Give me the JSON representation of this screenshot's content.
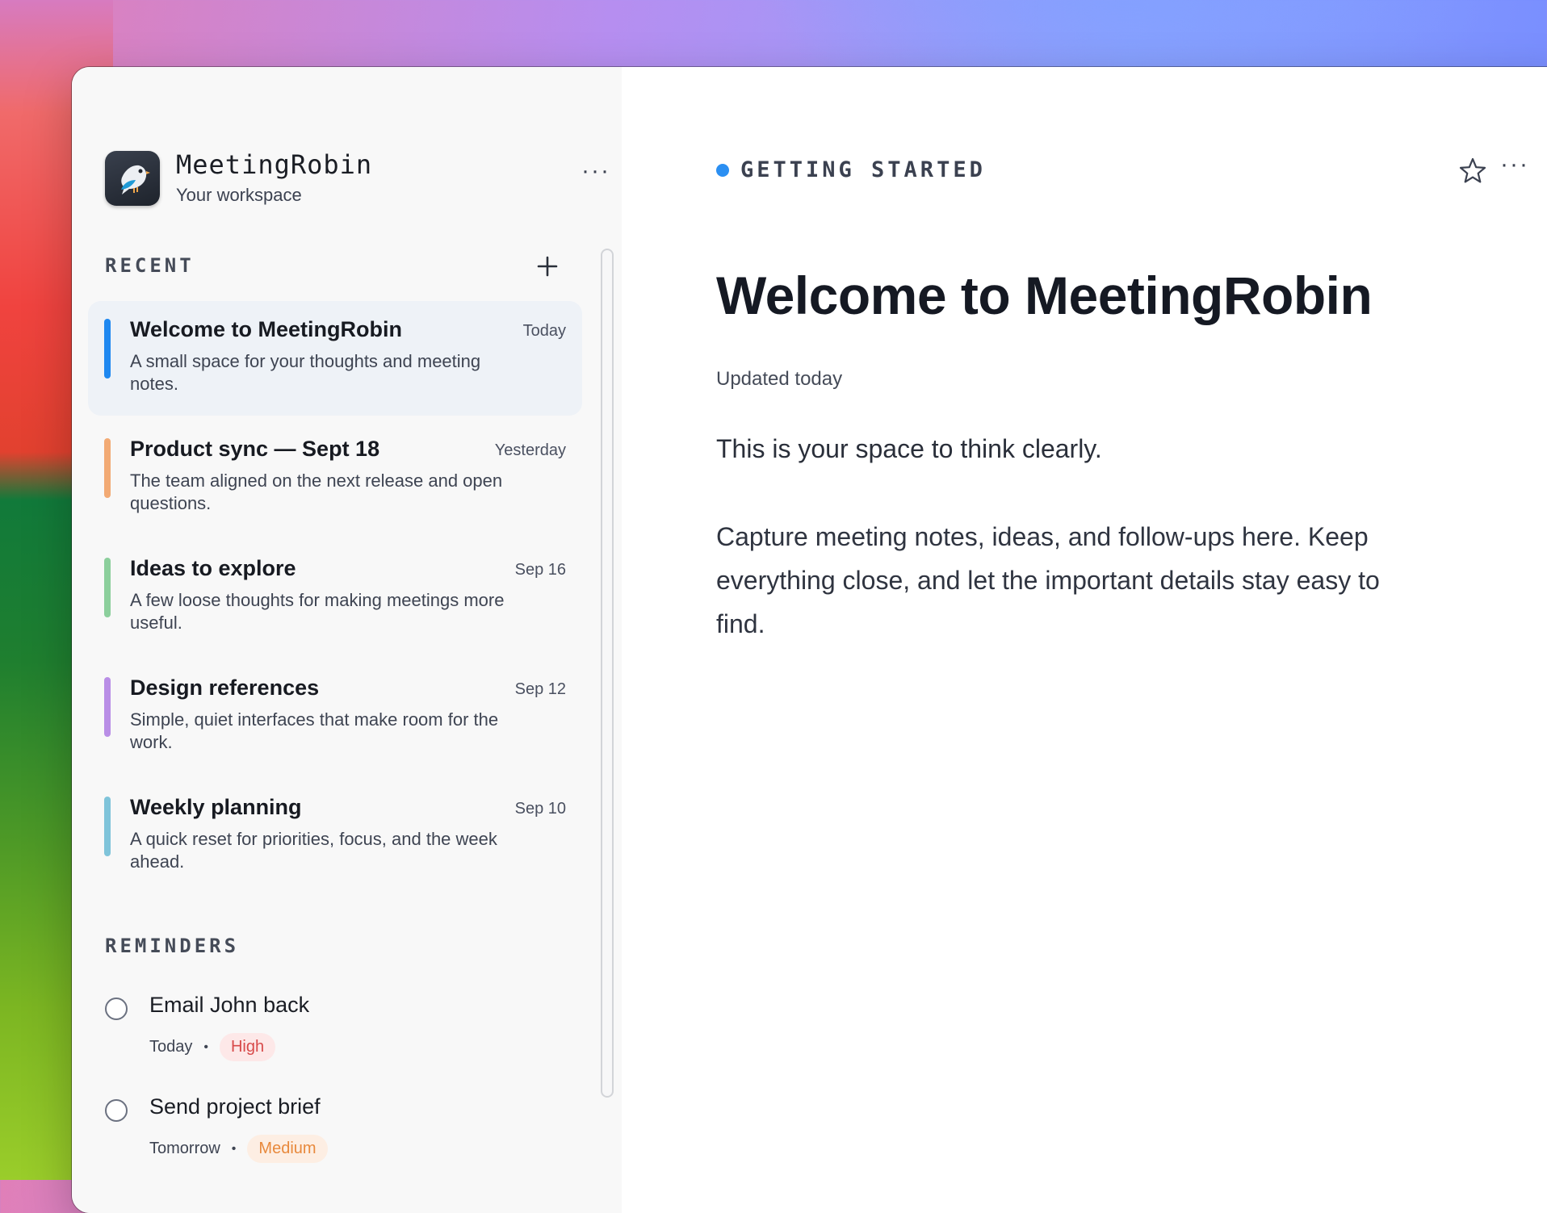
{
  "app": {
    "name": "MeetingRobin",
    "subtitle": "Your workspace",
    "more": "···",
    "logo_icon": "robin-bird-icon"
  },
  "recent": {
    "title": "RECENT",
    "add_icon": "plus-icon",
    "items": [
      {
        "title": "Welcome to MeetingRobin",
        "date": "Today",
        "desc": "A small space for your thoughts and meeting notes.",
        "color": "#1e88f0",
        "active": true
      },
      {
        "title": "Product sync — Sept 18",
        "date": "Yesterday",
        "desc": "The team aligned on the next release and open questions.",
        "color": "#f2aa74",
        "active": false
      },
      {
        "title": "Ideas to explore",
        "date": "Sep 16",
        "desc": "A few loose thoughts for making meetings more useful.",
        "color": "#8ccf9c",
        "active": false
      },
      {
        "title": "Design references",
        "date": "Sep 12",
        "desc": "Simple, quiet interfaces that make room for the work.",
        "color": "#b98ee6",
        "active": false
      },
      {
        "title": "Weekly planning",
        "date": "Sep 10",
        "desc": "A quick reset for priorities, focus, and the week ahead.",
        "color": "#7fc4da",
        "active": false
      }
    ]
  },
  "reminders": {
    "title": "REMINDERS",
    "items": [
      {
        "title": "Email John back",
        "when": "Today",
        "priority": "High",
        "level": "high"
      },
      {
        "title": "Send project brief",
        "when": "Tomorrow",
        "priority": "Medium",
        "level": "medium"
      }
    ]
  },
  "document": {
    "breadcrumb": "GETTING STARTED",
    "title": "Welcome to MeetingRobin",
    "updated": "Updated today",
    "lead": "This is your space to think clearly.",
    "body": "Capture meeting notes, ideas, and follow-ups here. Keep everything close, and let the important details stay easy to find.",
    "more": "···",
    "accent": "#2b8ff2"
  }
}
